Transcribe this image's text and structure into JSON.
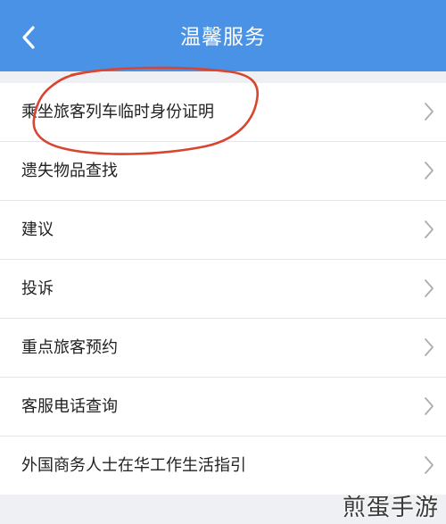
{
  "header": {
    "title": "温馨服务",
    "back_icon": "chevron-left-icon",
    "background_color": "#4a92e6"
  },
  "menu": {
    "items": [
      {
        "label": "乘坐旅客列车临时身份证明"
      },
      {
        "label": "遗失物品查找"
      },
      {
        "label": "建议"
      },
      {
        "label": "投诉"
      },
      {
        "label": "重点旅客预约"
      },
      {
        "label": "客服电话查询"
      },
      {
        "label": "外国商务人士在华工作生活指引"
      }
    ],
    "item_icon": "chevron-right-icon"
  },
  "annotation": {
    "shape": "hand-drawn-circle",
    "color": "#d9452f",
    "target": "乘坐旅客列车临时身份证明"
  },
  "watermark": {
    "text": "煎蛋手游"
  }
}
